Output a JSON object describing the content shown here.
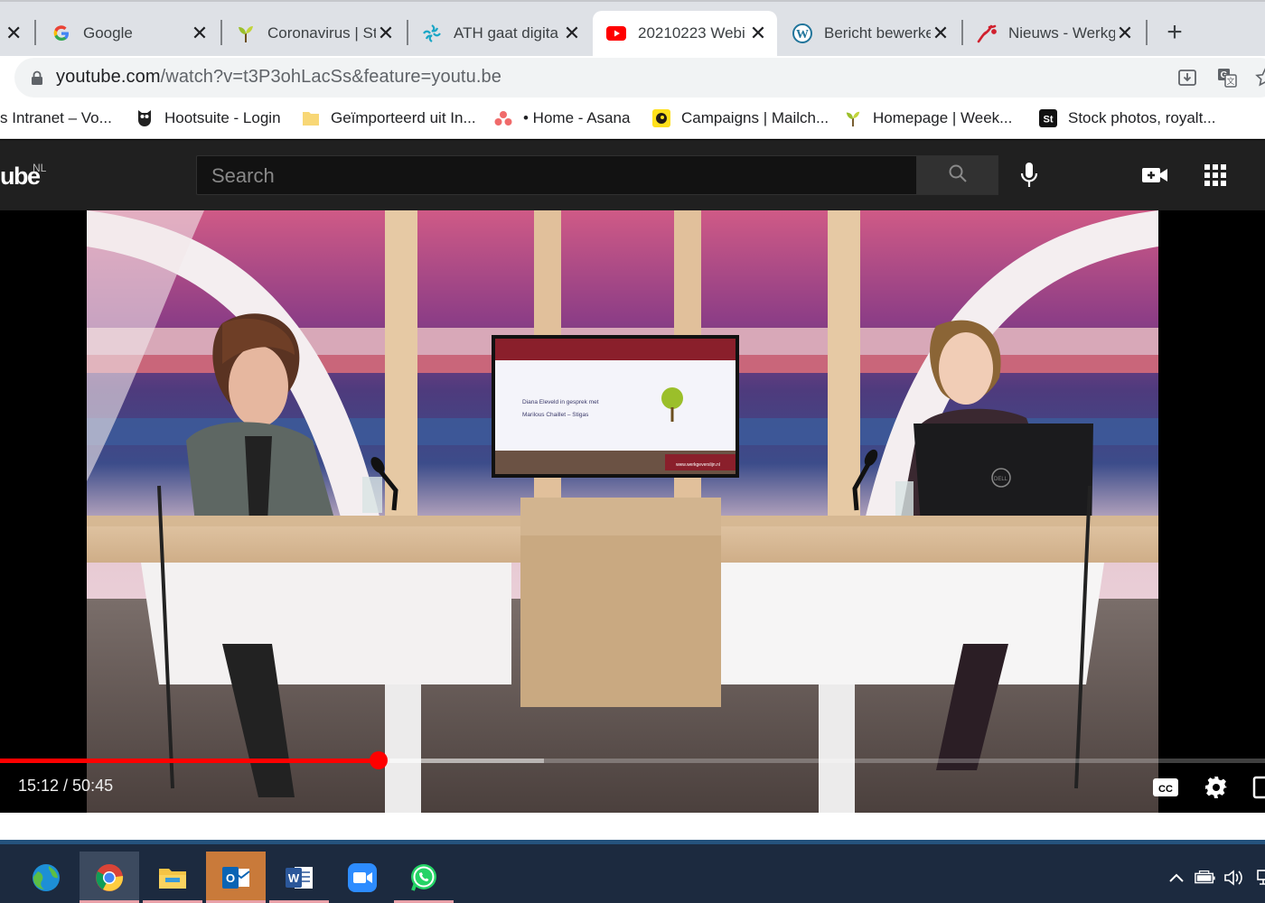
{
  "browser": {
    "tabs": [
      {
        "label": "Google",
        "icon": "google-g-icon",
        "active": false
      },
      {
        "label": "Coronavirus | St",
        "icon": "sprout-icon",
        "active": false
      },
      {
        "label": "ATH gaat digita",
        "icon": "ath-swirl-icon",
        "active": false
      },
      {
        "label": "20210223 Webi",
        "icon": "youtube-play-icon",
        "active": true
      },
      {
        "label": "Bericht bewerke",
        "icon": "wordpress-icon",
        "active": false
      },
      {
        "label": "Nieuws - Werkg",
        "icon": "werkgeverslijn-icon",
        "active": false
      }
    ],
    "close_glyph": "✕",
    "new_tab_glyph": "+",
    "url_domain": "youtube.com",
    "url_rest": "/watch?v=t3P3ohLacSs&feature=youtu.be",
    "bookmarks": [
      {
        "label": "s Intranet – Vo...",
        "icon": "intranet-icon"
      },
      {
        "label": "Hootsuite - Login",
        "icon": "hootsuite-owl-icon"
      },
      {
        "label": "Geïmporteerd uit In...",
        "icon": "folder-icon"
      },
      {
        "label": "• Home - Asana",
        "icon": "asana-icon"
      },
      {
        "label": "Campaigns | Mailch...",
        "icon": "mailchimp-icon"
      },
      {
        "label": "Homepage | Week...",
        "icon": "sprout-icon"
      },
      {
        "label": "Stock photos, royalt...",
        "icon": "shutterstock-icon"
      }
    ]
  },
  "youtube": {
    "logo_text": "ube",
    "region": "NL",
    "search_placeholder": "Search",
    "player": {
      "current_time": "15:12",
      "duration": "50:45",
      "time_display": "15:12 / 50:45",
      "played_fraction": 0.2995,
      "buffered_fraction": 0.43
    }
  },
  "video_frame": {
    "screen_line1": "Diana Eleveld in gesprek met",
    "screen_line2": "Marilous Chaillet – Stigas",
    "screen_url": "www.werkgeverslijn.nl",
    "laptop_brand": "DELL"
  },
  "taskbar": {
    "apps": [
      "browser-globe-icon",
      "chrome-icon",
      "file-explorer-icon",
      "outlook-icon",
      "word-icon",
      "zoom-icon",
      "whatsapp-icon"
    ]
  },
  "colors": {
    "youtube_red": "#ff0000",
    "header_bg": "#202020",
    "taskbar_bg": "#1c2a3f"
  }
}
